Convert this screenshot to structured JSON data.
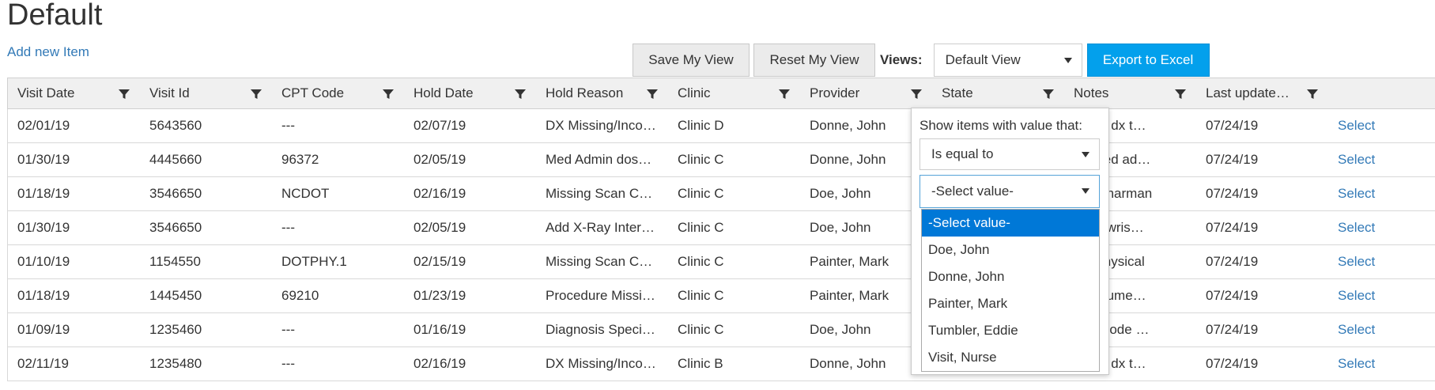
{
  "page": {
    "title": "Default",
    "add_link": "Add new Item"
  },
  "toolbar": {
    "save_label": "Save My View",
    "reset_label": "Reset My View",
    "views_label": "Views:",
    "views_value": "Default View",
    "export_label": "Export to Excel"
  },
  "columns": [
    "Visit Date",
    "Visit Id",
    "CPT Code",
    "Hold Date",
    "Hold Reason",
    "Clinic",
    "Provider",
    "State",
    "Notes",
    "Last update…"
  ],
  "rows": [
    [
      "02/01/19",
      "5643560",
      "---",
      "02/07/19",
      "DX Missing/Inco…",
      "Clinic D",
      "Donne, John",
      "",
      "e add dx t…",
      "07/24/19",
      "Select"
    ],
    [
      "01/30/19",
      "4445660",
      "96372",
      "02/05/19",
      "Med Admin dos…",
      "Clinic C",
      "Donne, John",
      "",
      "dd med ad…",
      "07/24/19",
      "Select"
    ],
    [
      "01/18/19",
      "3546650",
      "NCDOT",
      "02/16/19",
      "Missing Scan C…",
      "Clinic C",
      "Doe, John",
      "",
      "phy hharman",
      "07/24/19",
      "Select"
    ],
    [
      "01/30/19",
      "3546650",
      "---",
      "02/05/19",
      "Add X-Ray Inter…",
      "Clinic C",
      "Doe, John",
      "",
      "have wris…",
      "07/24/19",
      "Select"
    ],
    [
      "01/10/19",
      "1154550",
      "DOTPHY.1",
      "02/15/19",
      "Missing Scan C…",
      "Clinic C",
      "Painter, Mark",
      "",
      "dot physical",
      "07/24/19",
      "Select"
    ],
    [
      "01/18/19",
      "1445450",
      "69210",
      "01/23/19",
      "Procedure Missi…",
      "Clinic C",
      "Painter, Mark",
      "",
      "e docume…",
      "07/24/19",
      "Select"
    ],
    [
      "01/09/19",
      "1235460",
      "---",
      "01/16/19",
      "Diagnosis Speci…",
      "Clinic C",
      "Doe, John",
      "",
      "a dx code …",
      "07/24/19",
      "Select"
    ],
    [
      "02/11/19",
      "1235480",
      "---",
      "02/16/19",
      "DX Missing/Inco…",
      "Clinic B",
      "Donne, John",
      "",
      "e add dx t…",
      "07/24/19",
      "Select"
    ]
  ],
  "filter_popup": {
    "label": "Show items with value that:",
    "operator": "Is equal to",
    "value": "-Select value-",
    "options": [
      "-Select value-",
      "Doe, John",
      "Donne, John",
      "Painter, Mark",
      "Tumbler, Eddie",
      "Visit, Nurse"
    ]
  },
  "colors": {
    "link": "#337ab7",
    "export_button": "#03a0ec",
    "option_highlight": "#0078d7"
  }
}
